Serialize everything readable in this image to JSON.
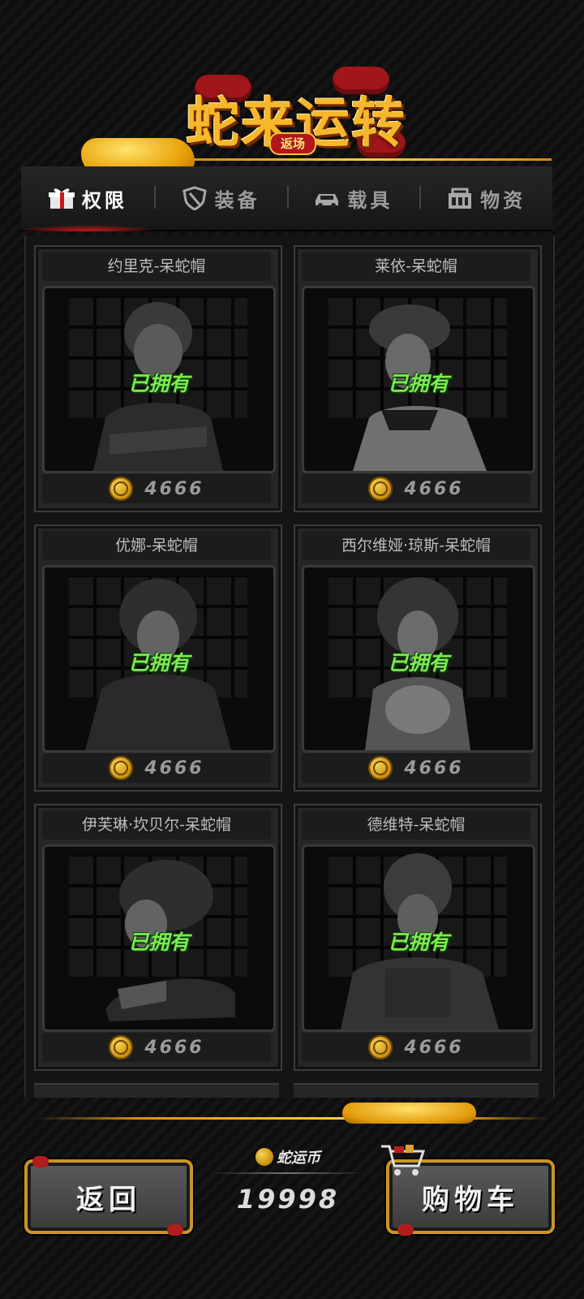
{
  "header": {
    "title": "蛇来运转",
    "badge": "返场"
  },
  "tabs": [
    {
      "label": "权限",
      "icon": "gift-box-icon",
      "active": true
    },
    {
      "label": "装备",
      "icon": "shield-icon",
      "active": false
    },
    {
      "label": "载具",
      "icon": "car-icon",
      "active": false
    },
    {
      "label": "物资",
      "icon": "supply-crate-icon",
      "active": false
    }
  ],
  "products": [
    {
      "name": "约里克-呆蛇帽",
      "status": "已拥有",
      "price": "4666"
    },
    {
      "name": "莱依-呆蛇帽",
      "status": "已拥有",
      "price": "4666"
    },
    {
      "name": "优娜-呆蛇帽",
      "status": "已拥有",
      "price": "4666"
    },
    {
      "name": "西尔维娅·琼斯-呆蛇帽",
      "status": "已拥有",
      "price": "4666"
    },
    {
      "name": "伊芙琳·坎贝尔-呆蛇帽",
      "status": "已拥有",
      "price": "4666"
    },
    {
      "name": "德维特-呆蛇帽",
      "status": "已拥有",
      "price": "4666"
    }
  ],
  "footer": {
    "back_label": "返回",
    "currency_label": "蛇运币",
    "currency_value": "19998",
    "cart_label": "购物车"
  },
  "colors": {
    "accent_gold": "#f5b82a",
    "owned_green": "#7dea52",
    "active_tab_red": "#d01818"
  }
}
